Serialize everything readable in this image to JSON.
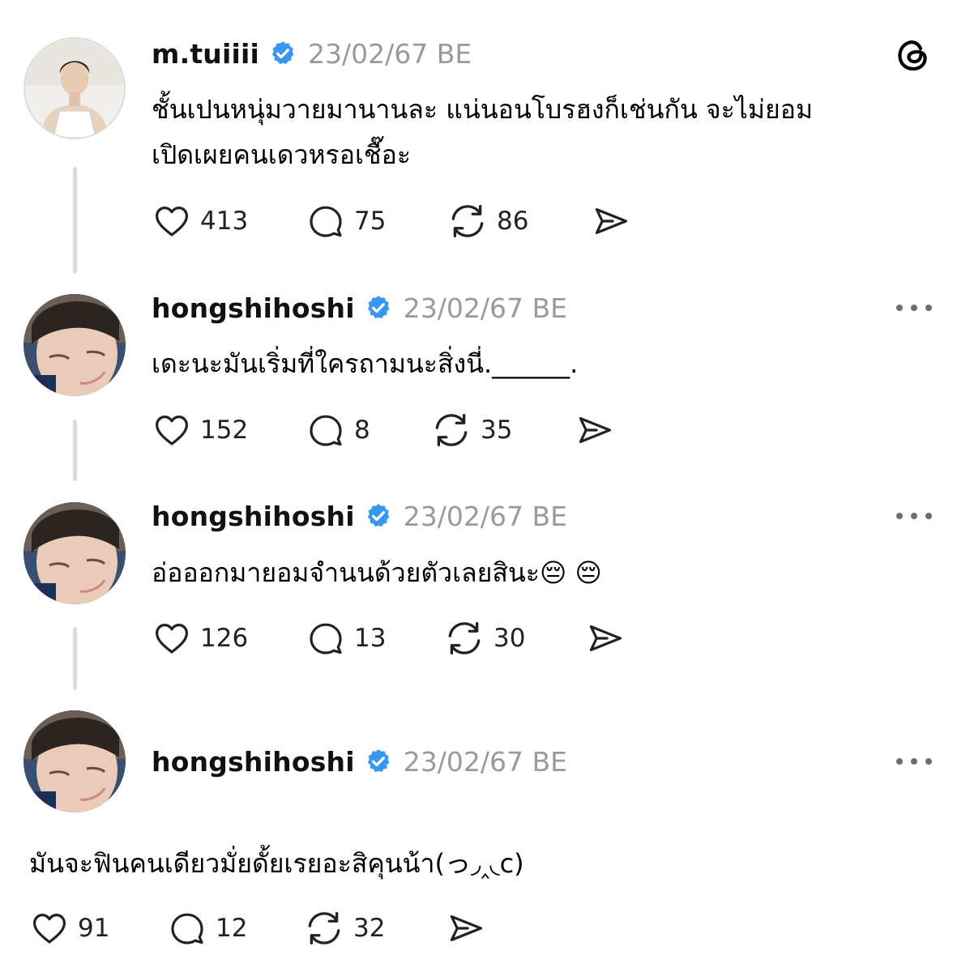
{
  "posts": [
    {
      "username": "m.tuiiii",
      "date": "23/02/67 BE",
      "text_lines": [
        "ชั้นเปนหนุ่มวายมานานละ แน่นอนโบรฮงก็เช่นกัน จะไม่ยอม",
        "เปิดเผยคนเดวหรอเชื๊อะ"
      ],
      "likes": "413",
      "replies": "75",
      "reposts": "86"
    },
    {
      "username": "hongshihoshi",
      "date": "23/02/67 BE",
      "text_lines": [
        "เดะนะมันเริ่มที่ใครถามนะสิ่งนี่.______."
      ],
      "likes": "152",
      "replies": "8",
      "reposts": "35"
    },
    {
      "username": "hongshihoshi",
      "date": "23/02/67 BE",
      "text_lines": [
        "อ่อออกมายอมจำนนด้วยตัวเลยสินะ😔 😔"
      ],
      "likes": "126",
      "replies": "13",
      "reposts": "30"
    },
    {
      "username": "hongshihoshi",
      "date": "23/02/67 BE",
      "text_lines": [
        "มันจะฟินคนเดียวมั่ยดั้ยเรยอะสิคุนน้า(っ◞‸◟c)"
      ],
      "likes": "91",
      "replies": "12",
      "reposts": "32"
    }
  ],
  "icons": {
    "like": "heart-icon",
    "reply": "comment-icon",
    "repost": "repost-icon",
    "share": "send-icon",
    "verified": "verified-badge-icon",
    "more": "more-options-icon",
    "app": "threads-logo-icon"
  },
  "colors": {
    "verified": "#3897f0",
    "date": "#9a9a9a",
    "thread_line": "#dcdcdc"
  }
}
